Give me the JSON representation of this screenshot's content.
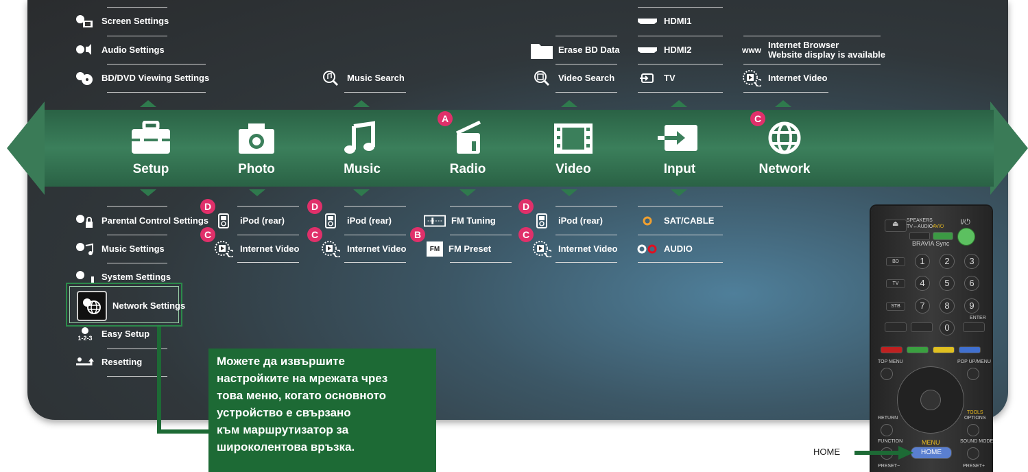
{
  "categories": [
    {
      "id": "setup",
      "label": "Setup",
      "icon": "toolbox-icon"
    },
    {
      "id": "photo",
      "label": "Photo",
      "icon": "camera-icon"
    },
    {
      "id": "music",
      "label": "Music",
      "icon": "music-note-icon"
    },
    {
      "id": "radio",
      "label": "Radio",
      "icon": "radio-icon",
      "badge": "A"
    },
    {
      "id": "video",
      "label": "Video",
      "icon": "film-icon"
    },
    {
      "id": "input",
      "label": "Input",
      "icon": "input-icon"
    },
    {
      "id": "network",
      "label": "Network",
      "icon": "globe-icon",
      "badge": "C"
    }
  ],
  "setup": {
    "above": [
      "Screen Settings",
      "Audio Settings",
      "BD/DVD Viewing Settings"
    ],
    "below": [
      "Parental Control Settings",
      "Music Settings",
      "System Settings",
      "Network Settings",
      "Easy Setup",
      "Resetting"
    ]
  },
  "photo": {
    "below": [
      "iPod (rear)",
      "Internet Video"
    ],
    "badges": [
      "D",
      "C"
    ]
  },
  "music": {
    "above": [
      "Music Search"
    ],
    "below": [
      "iPod (rear)",
      "Internet Video"
    ],
    "badges": [
      "D",
      "C"
    ]
  },
  "radio": {
    "below": [
      "FM Tuning",
      "FM Preset"
    ],
    "badge": "B",
    "fm_icon": "FM"
  },
  "video": {
    "above": [
      "Erase BD Data",
      "Video Search"
    ],
    "below": [
      "iPod (rear)",
      "Internet Video"
    ],
    "badges": [
      "D",
      "C"
    ]
  },
  "input": {
    "above": [
      "HDMI1",
      "HDMI2",
      "TV"
    ],
    "below": [
      "SAT/CABLE",
      "AUDIO"
    ]
  },
  "network": {
    "above_line1": "Internet Browser",
    "above_line2": "Website display is available",
    "above2": "Internet Video",
    "www": "www"
  },
  "easy_setup_icon": "1-2-3",
  "callout": [
    "Можете да извършите",
    "настройките на мрежата чрез",
    "това меню, когато основното",
    "устройство е свързано",
    "към маршрутизатор за",
    "широколентова връзка."
  ],
  "remote": {
    "home_label": "HOME",
    "home_button": "HOME",
    "menu": "MENU",
    "speakers": "SPEAKERS",
    "tv_audio": "TV↔AUDIO",
    "av": "AV/⏻",
    "power": "I/⏻",
    "bravia": "BRAVIA Sync",
    "bd": "BD",
    "tv": "TV",
    "stb": "STB",
    "digits": [
      "1",
      "2",
      "3",
      "4",
      "5",
      "6",
      "7",
      "8",
      "9",
      "0"
    ],
    "enter": "ENTER",
    "top_menu": "TOP MENU",
    "popup": "POP UP/MENU",
    "return": "RETURN",
    "tools": "TOOLS",
    "options": "OPTIONS",
    "function": "FUNCTION",
    "sound_mode": "SOUND MODE",
    "preset_minus": "PRESET−",
    "preset_plus": "PRESET+"
  },
  "colors": {
    "band": "#3b7f5b",
    "badge": "#e0306a",
    "callout": "#1d6a35",
    "home": "#5a7fd0"
  }
}
